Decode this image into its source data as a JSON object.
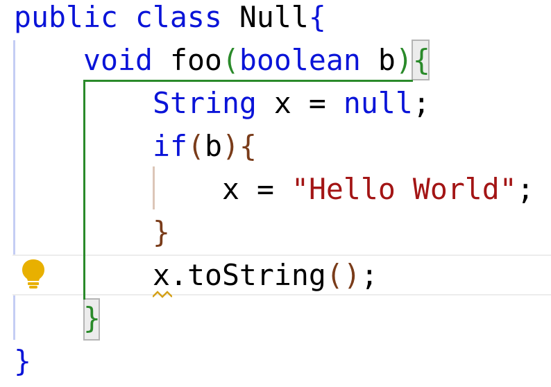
{
  "editor": {
    "language": "Java",
    "lines": [
      {
        "indent": 0,
        "tokens": [
          {
            "t": "public",
            "c": "kw"
          },
          {
            "t": " ",
            "c": "id"
          },
          {
            "t": "class",
            "c": "kw"
          },
          {
            "t": " ",
            "c": "id"
          },
          {
            "t": "Null",
            "c": "id"
          },
          {
            "t": "{",
            "c": "p0"
          }
        ]
      },
      {
        "indent": 1,
        "tokens": [
          {
            "t": "void",
            "c": "kw"
          },
          {
            "t": " ",
            "c": "id"
          },
          {
            "t": "foo",
            "c": "id"
          },
          {
            "t": "(",
            "c": "p1"
          },
          {
            "t": "boolean",
            "c": "kw"
          },
          {
            "t": " b",
            "c": "id"
          },
          {
            "t": ")",
            "c": "p1"
          },
          {
            "t": "{",
            "c": "p1"
          }
        ]
      },
      {
        "indent": 2,
        "tokens": [
          {
            "t": "String",
            "c": "kw"
          },
          {
            "t": " x = ",
            "c": "id"
          },
          {
            "t": "null",
            "c": "kw"
          },
          {
            "t": ";",
            "c": "id"
          }
        ]
      },
      {
        "indent": 2,
        "tokens": [
          {
            "t": "if",
            "c": "kw"
          },
          {
            "t": "(",
            "c": "p2"
          },
          {
            "t": "b",
            "c": "id"
          },
          {
            "t": ")",
            "c": "p2"
          },
          {
            "t": "{",
            "c": "p2"
          }
        ]
      },
      {
        "indent": 3,
        "tokens": [
          {
            "t": "x = ",
            "c": "id"
          },
          {
            "t": "\"Hello World\"",
            "c": "str"
          },
          {
            "t": ";",
            "c": "id"
          }
        ]
      },
      {
        "indent": 2,
        "tokens": [
          {
            "t": "}",
            "c": "p2"
          }
        ]
      },
      {
        "indent": 2,
        "tokens": [
          {
            "t": "x.toString",
            "c": "id"
          },
          {
            "t": "(",
            "c": "p2"
          },
          {
            "t": ")",
            "c": "p2"
          },
          {
            "t": ";",
            "c": "id"
          }
        ]
      },
      {
        "indent": 1,
        "tokens": [
          {
            "t": "}",
            "c": "p1"
          }
        ]
      },
      {
        "indent": 0,
        "tokens": [
          {
            "t": "}",
            "c": "p0"
          }
        ]
      }
    ]
  },
  "gutter": {
    "intention_icon": "lightbulb-icon",
    "intention_color": "#e8b000"
  },
  "warning": {
    "icon": "squiggle-underline-icon",
    "color": "#d4a017"
  },
  "colors": {
    "keyword": "#0a14d8",
    "string": "#a31515",
    "brace_level1": "#0a14d8",
    "brace_level2": "#2a8a2a",
    "brace_level3": "#7a3c1a",
    "identifier": "#000000"
  }
}
